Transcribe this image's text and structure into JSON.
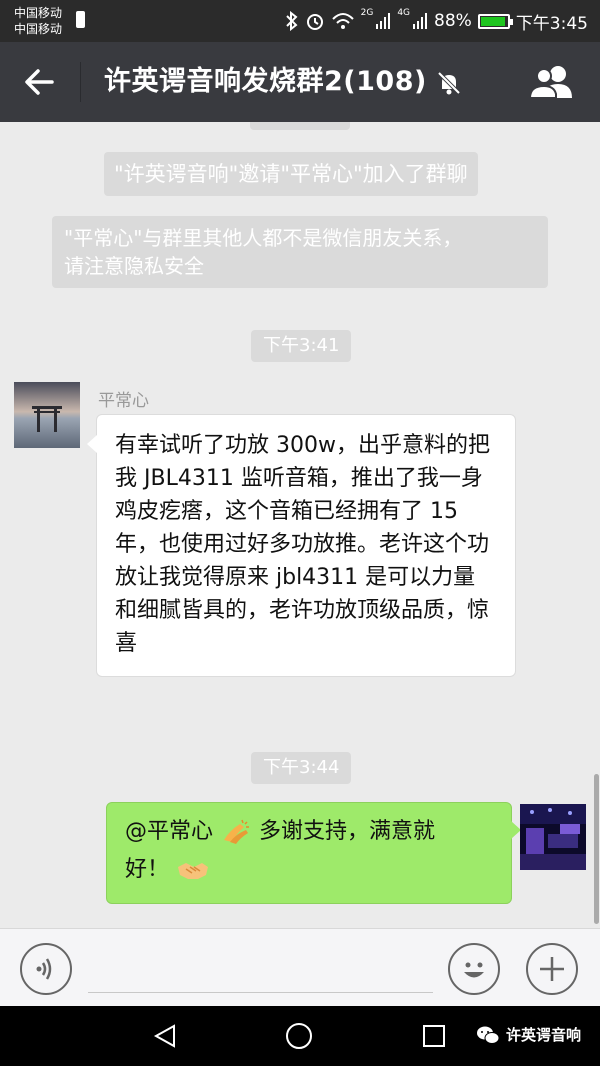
{
  "status_bar": {
    "carrier1": "中国移动",
    "carrier2": "中国移动",
    "signal1": "2G",
    "signal2": "4G",
    "battery": "88%",
    "battery_level": 0.88,
    "time": "下午3:45"
  },
  "header": {
    "title": "许英谔音响发烧群2(108)",
    "icons": [
      "back-arrow-icon",
      "mute-bell-icon",
      "group-members-icon"
    ]
  },
  "chat": {
    "system_invite": "\"许英谔音响\"邀请\"平常心\"加入了群聊",
    "system_privacy_line1": "\"平常心\"与群里其他人都不是微信朋友关系，",
    "system_privacy_line2": "请注意隐私安全",
    "time1": "下午3:41",
    "sender": "平常心",
    "message1": "有幸试听了功放 300w，出乎意料的把我 JBL4311 监听音箱，推出了我一身鸡皮疙瘩，这个音箱已经拥有了 15 年，也使用过好多功放推。老许这个功放让我觉得原来 jbl4311 是可以力量和细腻皆具的，老许功放顶级品质，惊喜",
    "time2": "下午3:44",
    "reply_mention": "@平常心",
    "reply_text1": "多谢支持，满意就",
    "reply_text2": "好！"
  },
  "watermark": "许英谔音响",
  "colors": {
    "header_bg": "#393a3f",
    "chat_bg": "#ebebeb",
    "my_bubble": "#9eea6a",
    "other_bubble": "#ffffff",
    "battery_fill": "#1ec51e"
  }
}
